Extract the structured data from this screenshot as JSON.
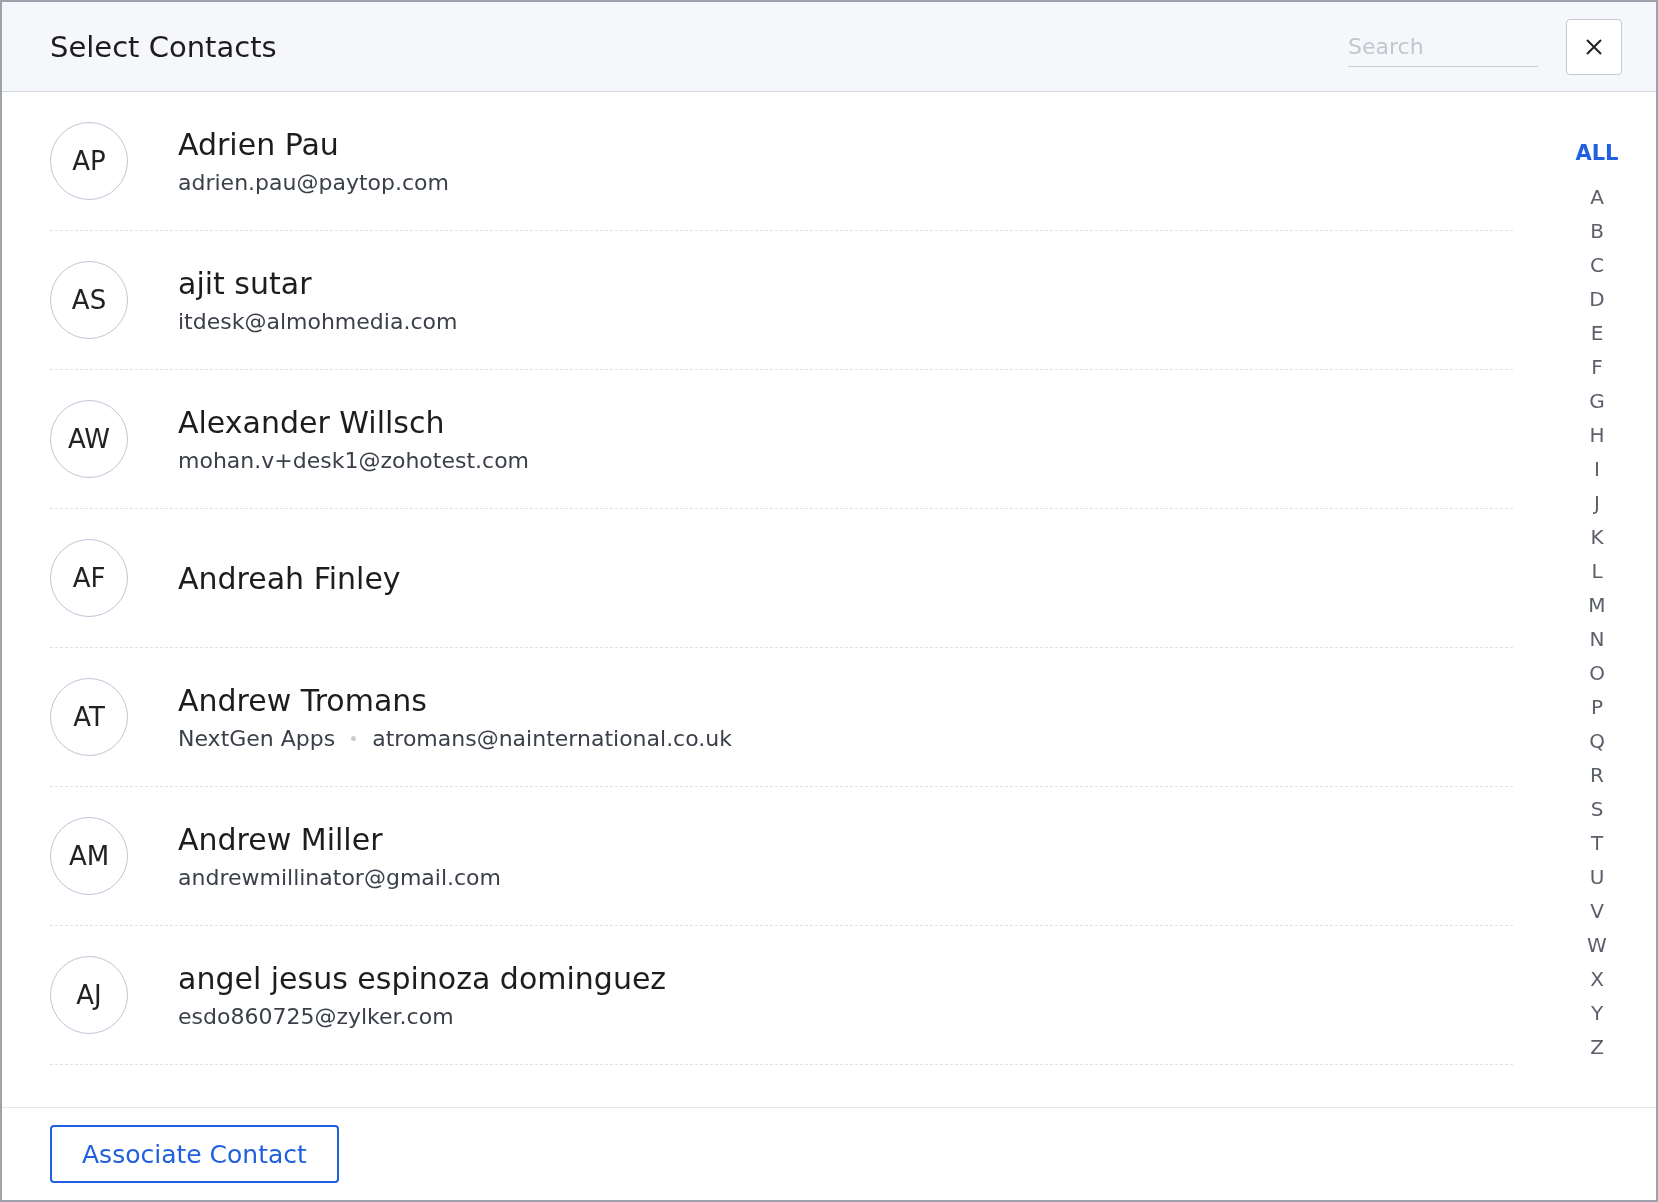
{
  "dialog": {
    "title": "Select Contacts",
    "search": {
      "placeholder": "Search"
    }
  },
  "contacts": [
    {
      "initials": "AP",
      "name": "Adrien Pau",
      "email": "adrien.pau@paytop.com"
    },
    {
      "initials": "AS",
      "name": "ajit sutar",
      "email": "itdesk@almohmedia.com"
    },
    {
      "initials": "AW",
      "name": "Alexander Willsch",
      "email": "mohan.v+desk1@zohotest.com"
    },
    {
      "initials": "AF",
      "name": "Andreah Finley"
    },
    {
      "initials": "AT",
      "name": "Andrew Tromans",
      "company": "NextGen Apps",
      "email": "atromans@nainternational.co.uk"
    },
    {
      "initials": "AM",
      "name": "Andrew Miller",
      "email": "andrewmillinator@gmail.com"
    },
    {
      "initials": "AJ",
      "name": "angel jesus espinoza dominguez",
      "email": "esdo860725@zylker.com"
    }
  ],
  "alphabet_index": [
    {
      "label": "ALL",
      "selected": true
    },
    {
      "label": "A",
      "selected": false
    },
    {
      "label": "B",
      "selected": false
    },
    {
      "label": "C",
      "selected": false
    },
    {
      "label": "D",
      "selected": false
    },
    {
      "label": "E",
      "selected": false
    },
    {
      "label": "F",
      "selected": false
    },
    {
      "label": "G",
      "selected": false
    },
    {
      "label": "H",
      "selected": false
    },
    {
      "label": "I",
      "selected": false
    },
    {
      "label": "J",
      "selected": false
    },
    {
      "label": "K",
      "selected": false
    },
    {
      "label": "L",
      "selected": false
    },
    {
      "label": "M",
      "selected": false
    },
    {
      "label": "N",
      "selected": false
    },
    {
      "label": "O",
      "selected": false
    },
    {
      "label": "P",
      "selected": false
    },
    {
      "label": "Q",
      "selected": false
    },
    {
      "label": "R",
      "selected": false
    },
    {
      "label": "S",
      "selected": false
    },
    {
      "label": "T",
      "selected": false
    },
    {
      "label": "U",
      "selected": false
    },
    {
      "label": "V",
      "selected": false
    },
    {
      "label": "W",
      "selected": false
    },
    {
      "label": "X",
      "selected": false
    },
    {
      "label": "Y",
      "selected": false
    },
    {
      "label": "Z",
      "selected": false
    }
  ],
  "footer": {
    "button": "Associate Contact"
  }
}
